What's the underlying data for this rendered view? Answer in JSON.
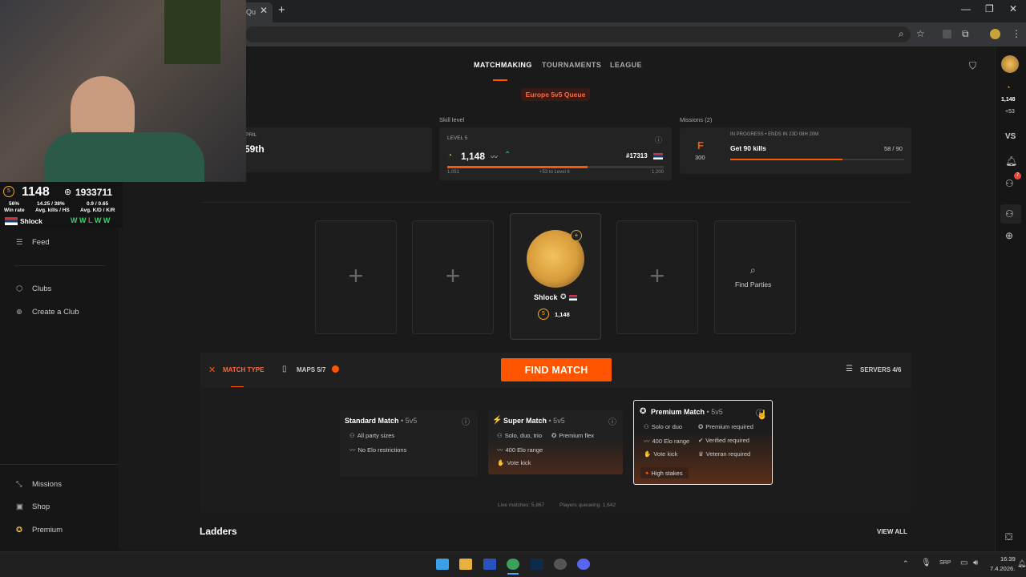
{
  "browser": {
    "tab_fragment": "Qu",
    "close": "✕",
    "new_tab": "+",
    "min": "—",
    "restore": "❐",
    "win_close": "✕"
  },
  "nav": {
    "tabs": [
      "MATCHMAKING",
      "TOURNAMENTS",
      "LEAGUE"
    ],
    "queue": "Europe 5v5 Queue"
  },
  "cards": {
    "left_partial_label": "PRIL",
    "left_partial_value": "59th",
    "skill_section": "Skill level",
    "skill_level_label": "LEVEL 5",
    "elo": "1,148",
    "rank": "#17313",
    "elo_min": "1,051",
    "elo_to_next": "+53 to Level 6",
    "elo_max": "1,200",
    "missions_section": "Missions (2)",
    "mission_grade": "F",
    "mission_points": "300",
    "mission_status": "IN PROGRESS • ENDS IN 23D 08H 20M",
    "mission_title": "Get 90 kills",
    "mission_progress": "58 / 90",
    "mission_fraction": 0.644
  },
  "party": {
    "player_name": "Shlock",
    "player_level": "5",
    "player_elo": "1,148",
    "find_parties": "Find Parties"
  },
  "matchbar": {
    "match_type": "MATCH TYPE",
    "maps": "MAPS 5/7",
    "find_match": "FIND MATCH",
    "servers": "SERVERS 4/6"
  },
  "modes": {
    "standard": {
      "title": "Standard Match",
      "sub": "• 5v5",
      "features": [
        "All party sizes",
        "No Elo restrictions"
      ]
    },
    "super": {
      "title": "Super Match",
      "sub": "• 5v5",
      "features": [
        "Solo, duo, trio",
        "Premium flex",
        "400 Elo range",
        "Vote kick"
      ]
    },
    "premium": {
      "title": "Premium Match",
      "sub": "• 5v5",
      "features": [
        "Solo or duo",
        "Premium required",
        "400 Elo range",
        "Verified required",
        "Vote kick",
        "Veteran required"
      ],
      "badge": "High stakes"
    }
  },
  "footer_stats": {
    "live": "Live matches: 5,867",
    "queue": "Players queueing: 1,642"
  },
  "ladders": {
    "title": "Ladders",
    "view_all": "VIEW ALL"
  },
  "sidebar": {
    "items": [
      "Feed",
      "Clubs",
      "Create a Club",
      "Missions",
      "Shop",
      "Premium"
    ]
  },
  "rail": {
    "elo": "1,148",
    "delta": "+53",
    "vs": "VS",
    "notif_count": "7"
  },
  "overlay": {
    "elo": "1148",
    "points": "1933711",
    "winrate": "56%",
    "winrate_label": "Win rate",
    "kills": "14.25 / 38%",
    "kills_label": "Avg. kills / HS",
    "kd": "0.9 / 0.65",
    "kd_label": "Avg. K/D / K/R",
    "name": "Shlock",
    "form": [
      "W",
      "W",
      "L",
      "W",
      "W"
    ]
  },
  "taskbar": {
    "lang": "SRP",
    "time": "16:39",
    "date": "7.4.2026."
  },
  "colors": {
    "accent": "#ff5500",
    "win": "#3bd16f",
    "loss": "#e84545"
  }
}
